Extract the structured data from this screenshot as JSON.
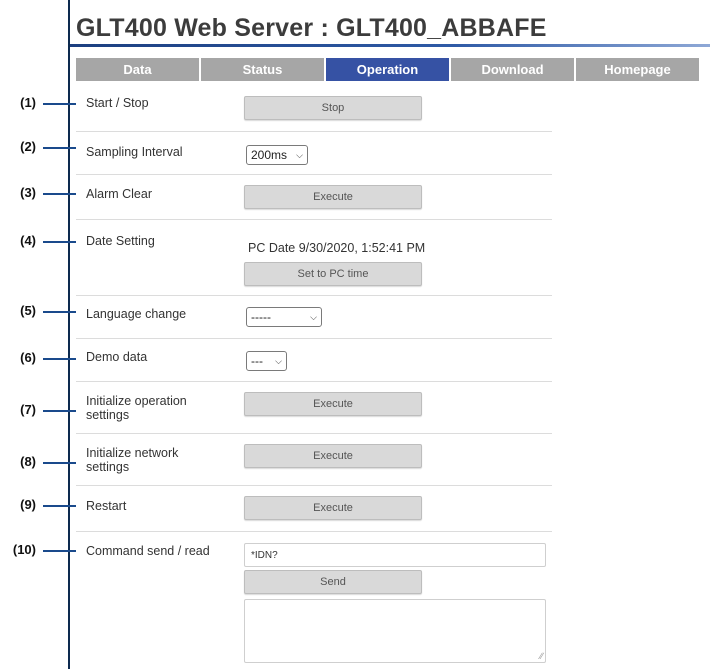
{
  "page": {
    "title": "GLT400 Web Server : GLT400_ABBAFE"
  },
  "nav": {
    "tabs": [
      "Data",
      "Status",
      "Operation",
      "Download",
      "Homepage"
    ],
    "active": "Operation"
  },
  "operation": {
    "start_stop": {
      "num": "(1)",
      "label": "Start / Stop",
      "button": "Stop"
    },
    "sampling": {
      "num": "(2)",
      "label": "Sampling Interval",
      "value": "200ms"
    },
    "alarm": {
      "num": "(3)",
      "label": "Alarm Clear",
      "button": "Execute"
    },
    "date": {
      "num": "(4)",
      "label": "Date Setting",
      "pc_date": "PC Date 9/30/2020, 1:52:41 PM",
      "button": "Set to PC time"
    },
    "language": {
      "num": "(5)",
      "label": "Language change",
      "value": "-----"
    },
    "demo": {
      "num": "(6)",
      "label": "Demo data",
      "value": "---"
    },
    "init_op": {
      "num": "(7)",
      "label_line1": "Initialize operation",
      "label_line2": "settings",
      "button": "Execute"
    },
    "init_net": {
      "num": "(8)",
      "label_line1": "Initialize network",
      "label_line2": "settings",
      "button": "Execute"
    },
    "restart": {
      "num": "(9)",
      "label": "Restart",
      "button": "Execute"
    },
    "command": {
      "num": "(10)",
      "label": "Command send / read",
      "input_value": "*IDN?",
      "button": "Send",
      "output": ""
    }
  },
  "icons": {
    "select_chevron": "chevron-down-icon",
    "resize_grip": "resize-grip-icon"
  },
  "colors": {
    "tab_active": "#3652a4",
    "tab_inactive": "#a6a6a6",
    "callout_line": "#1a4a8c",
    "title_rule": "#2e5aa6"
  }
}
